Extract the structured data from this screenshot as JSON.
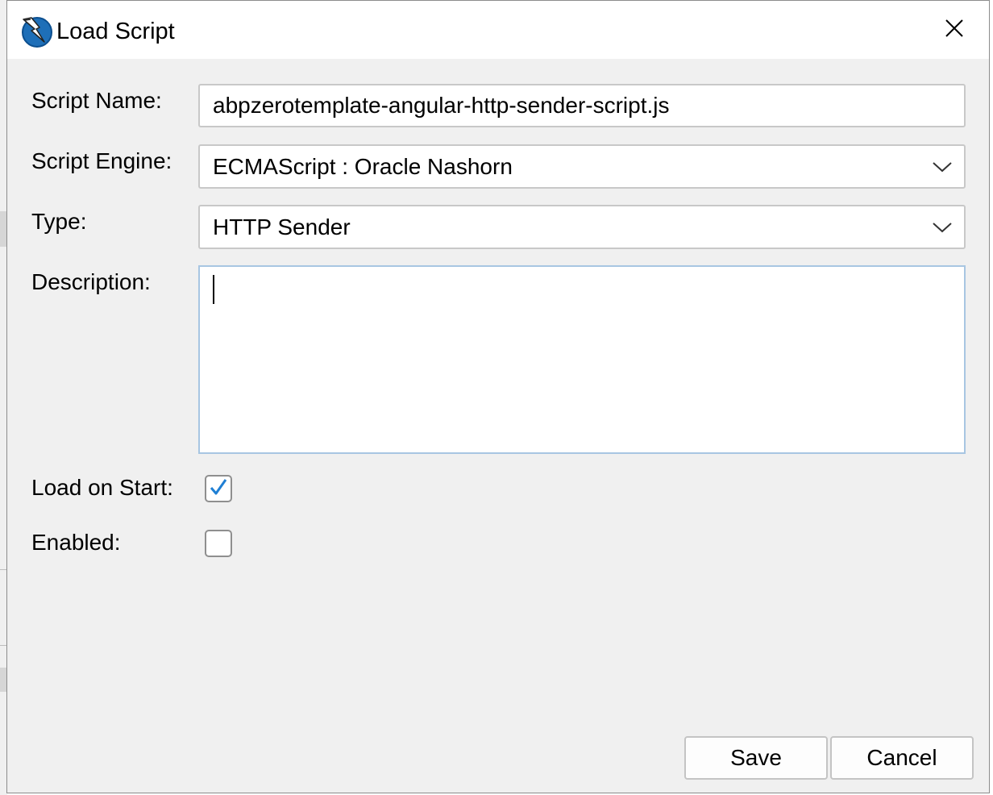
{
  "dialog": {
    "title": "Load Script",
    "icon": "zap-logo-icon"
  },
  "form": {
    "script_name_label": "Script Name:",
    "script_name_value": "abpzerotemplate-angular-http-sender-script.js",
    "script_engine_label": "Script Engine:",
    "script_engine_value": "ECMAScript : Oracle Nashorn",
    "type_label": "Type:",
    "type_value": "HTTP Sender",
    "description_label": "Description:",
    "description_value": "",
    "load_on_start_label": "Load on Start:",
    "load_on_start_checked": true,
    "enabled_label": "Enabled:",
    "enabled_checked": false
  },
  "buttons": {
    "save_label": "Save",
    "cancel_label": "Cancel"
  },
  "colors": {
    "check_accent": "#1f7fd4",
    "focus_border": "#a8c6e2"
  }
}
